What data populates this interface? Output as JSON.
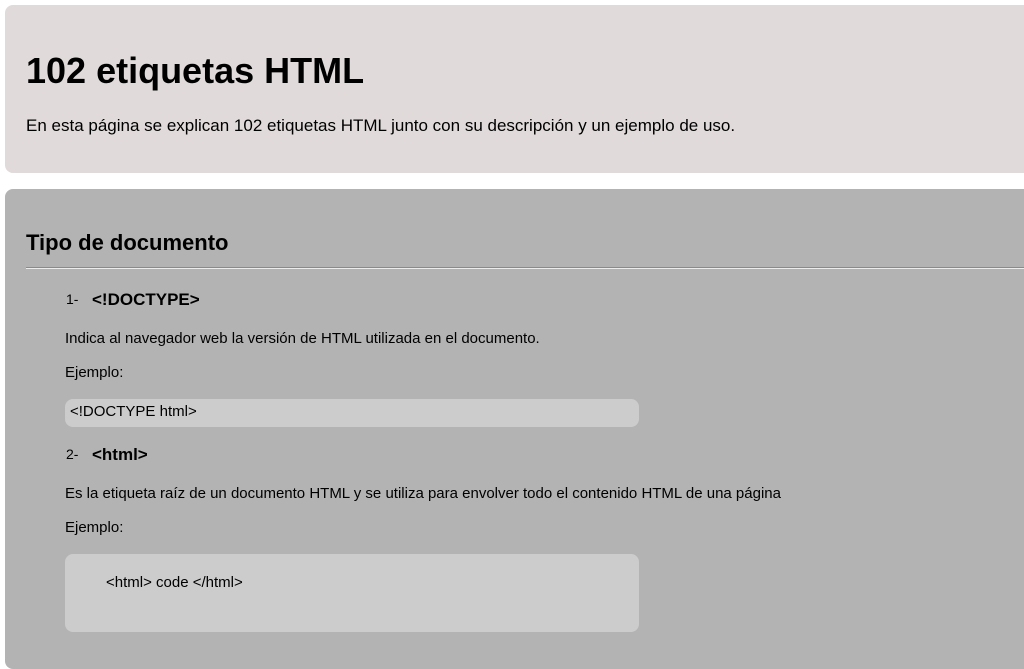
{
  "header": {
    "title": "102 etiquetas HTML",
    "intro": "En esta página se explican 102 etiquetas HTML junto con su descripción y un ejemplo de uso."
  },
  "section": {
    "title": "Tipo de documento",
    "tags": [
      {
        "number": "1-",
        "name": "<!DOCTYPE>",
        "description": "Indica al navegador web la versión de HTML utilizada en el documento.",
        "example_label": "Ejemplo:",
        "example_code": "<!DOCTYPE html>"
      },
      {
        "number": "2-",
        "name": "<html>",
        "description": "Es la etiqueta raíz de un documento HTML y se utiliza para envolver todo el contenido HTML de una página",
        "example_label": "Ejemplo:",
        "example_code": "<html> code </html>"
      }
    ]
  },
  "colors": {
    "header_bg": "#e0dada",
    "section_bg": "#b3b3b3",
    "code_bg": "#cccccc"
  }
}
